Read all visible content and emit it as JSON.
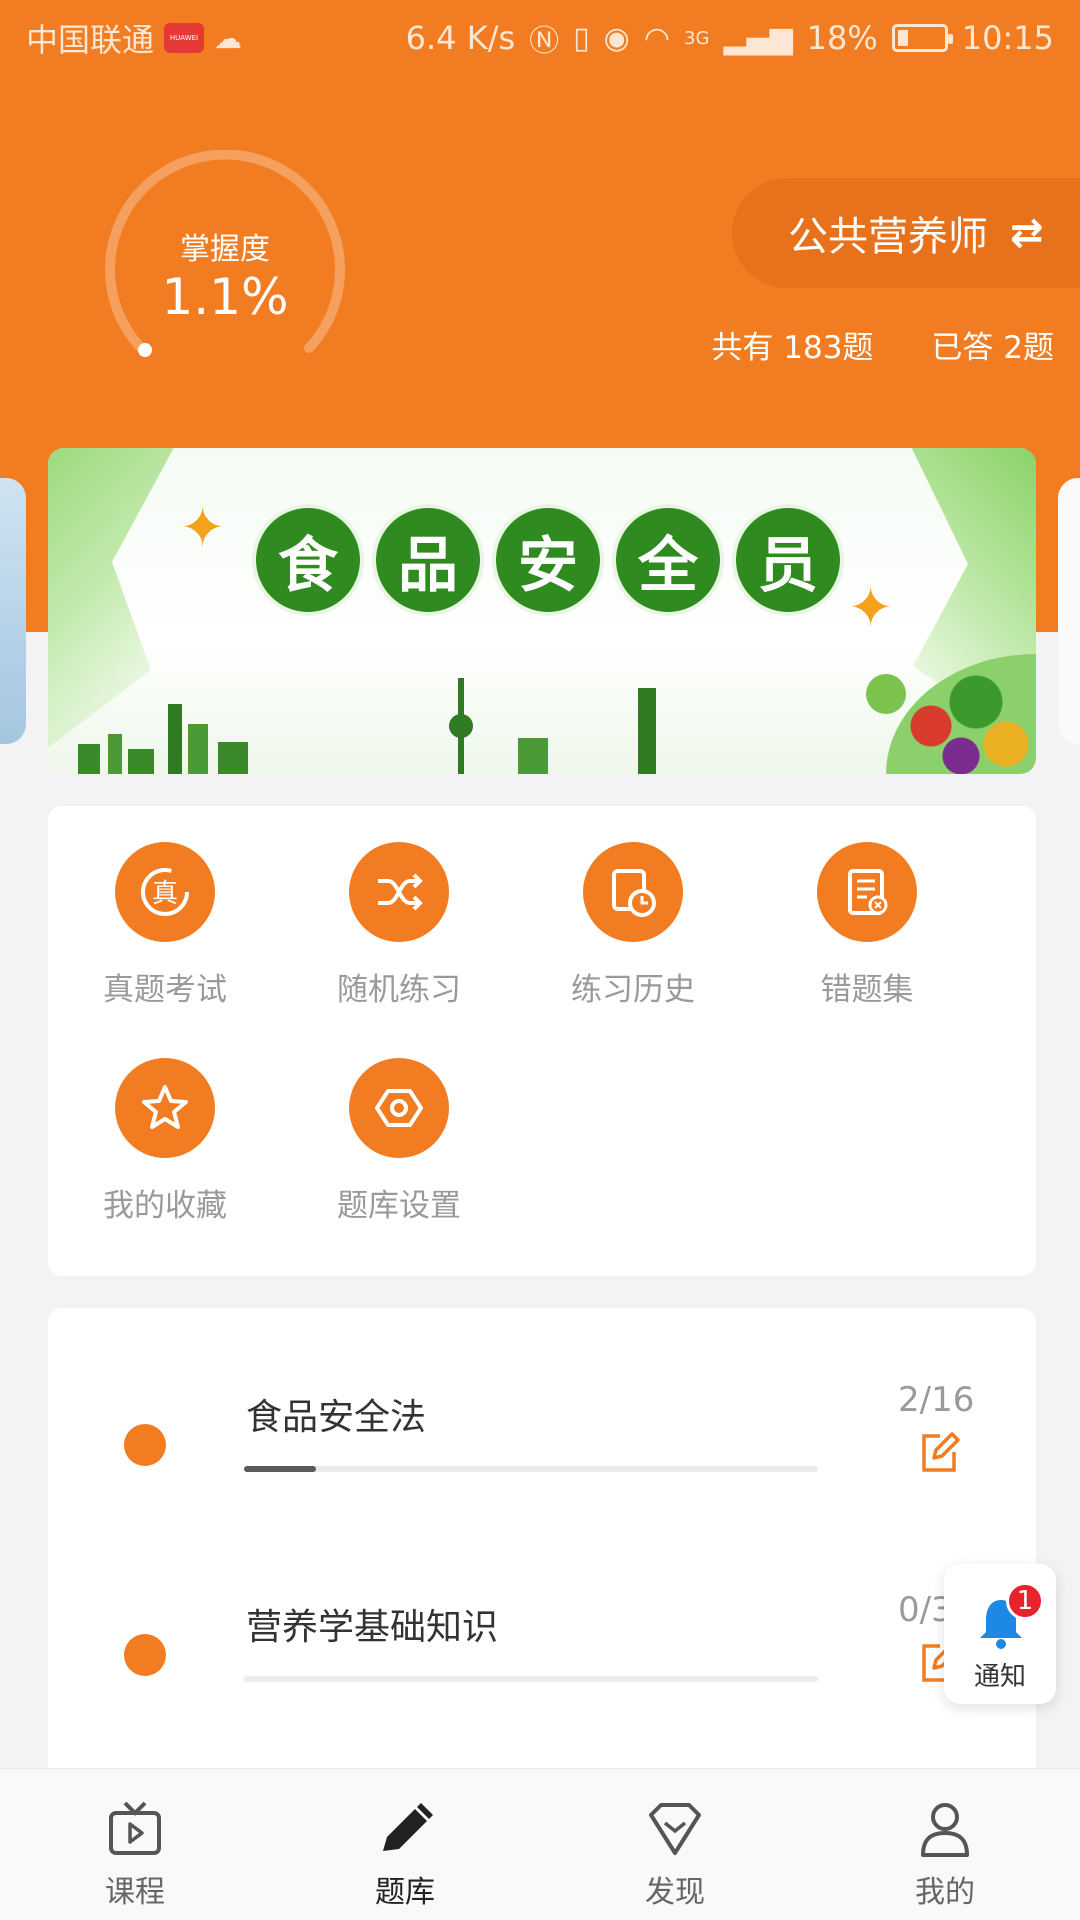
{
  "status_bar": {
    "carrier": "中国联通",
    "badge": "HUAWEI",
    "net_speed": "6.4 K/s",
    "signal": "3G",
    "battery": "18%",
    "time": "10:15"
  },
  "mastery": {
    "label": "掌握度",
    "value": "1.1%",
    "fraction": 0.011
  },
  "course": {
    "name": "公共营养师"
  },
  "counts": {
    "total": "共有 183题",
    "answered": "已答 2题"
  },
  "banner": {
    "chars": [
      "食",
      "品",
      "安",
      "全",
      "员"
    ]
  },
  "tools": [
    {
      "label": "真题考试",
      "icon": "exam-icon"
    },
    {
      "label": "随机练习",
      "icon": "shuffle-icon"
    },
    {
      "label": "练习历史",
      "icon": "history-icon"
    },
    {
      "label": "错题集",
      "icon": "wrong-questions-icon"
    },
    {
      "label": "我的收藏",
      "icon": "star-icon"
    },
    {
      "label": "题库设置",
      "icon": "settings-icon"
    }
  ],
  "chapters": [
    {
      "title": "食品安全法",
      "count": "2/16",
      "progress": 0.125
    },
    {
      "title": "营养学基础知识",
      "count": "0/3",
      "progress": 0.0
    }
  ],
  "notification": {
    "label": "通知",
    "badge": "1"
  },
  "bottom_nav": [
    {
      "label": "课程",
      "icon": "tv-icon"
    },
    {
      "label": "题库",
      "icon": "pencil-icon",
      "active": true
    },
    {
      "label": "发现",
      "icon": "diamond-icon"
    },
    {
      "label": "我的",
      "icon": "user-icon"
    }
  ],
  "colors": {
    "accent": "#f17c21",
    "banner_green": "#2f8a1f",
    "badge_red": "#e8232b",
    "bell_blue": "#1e88e5"
  }
}
